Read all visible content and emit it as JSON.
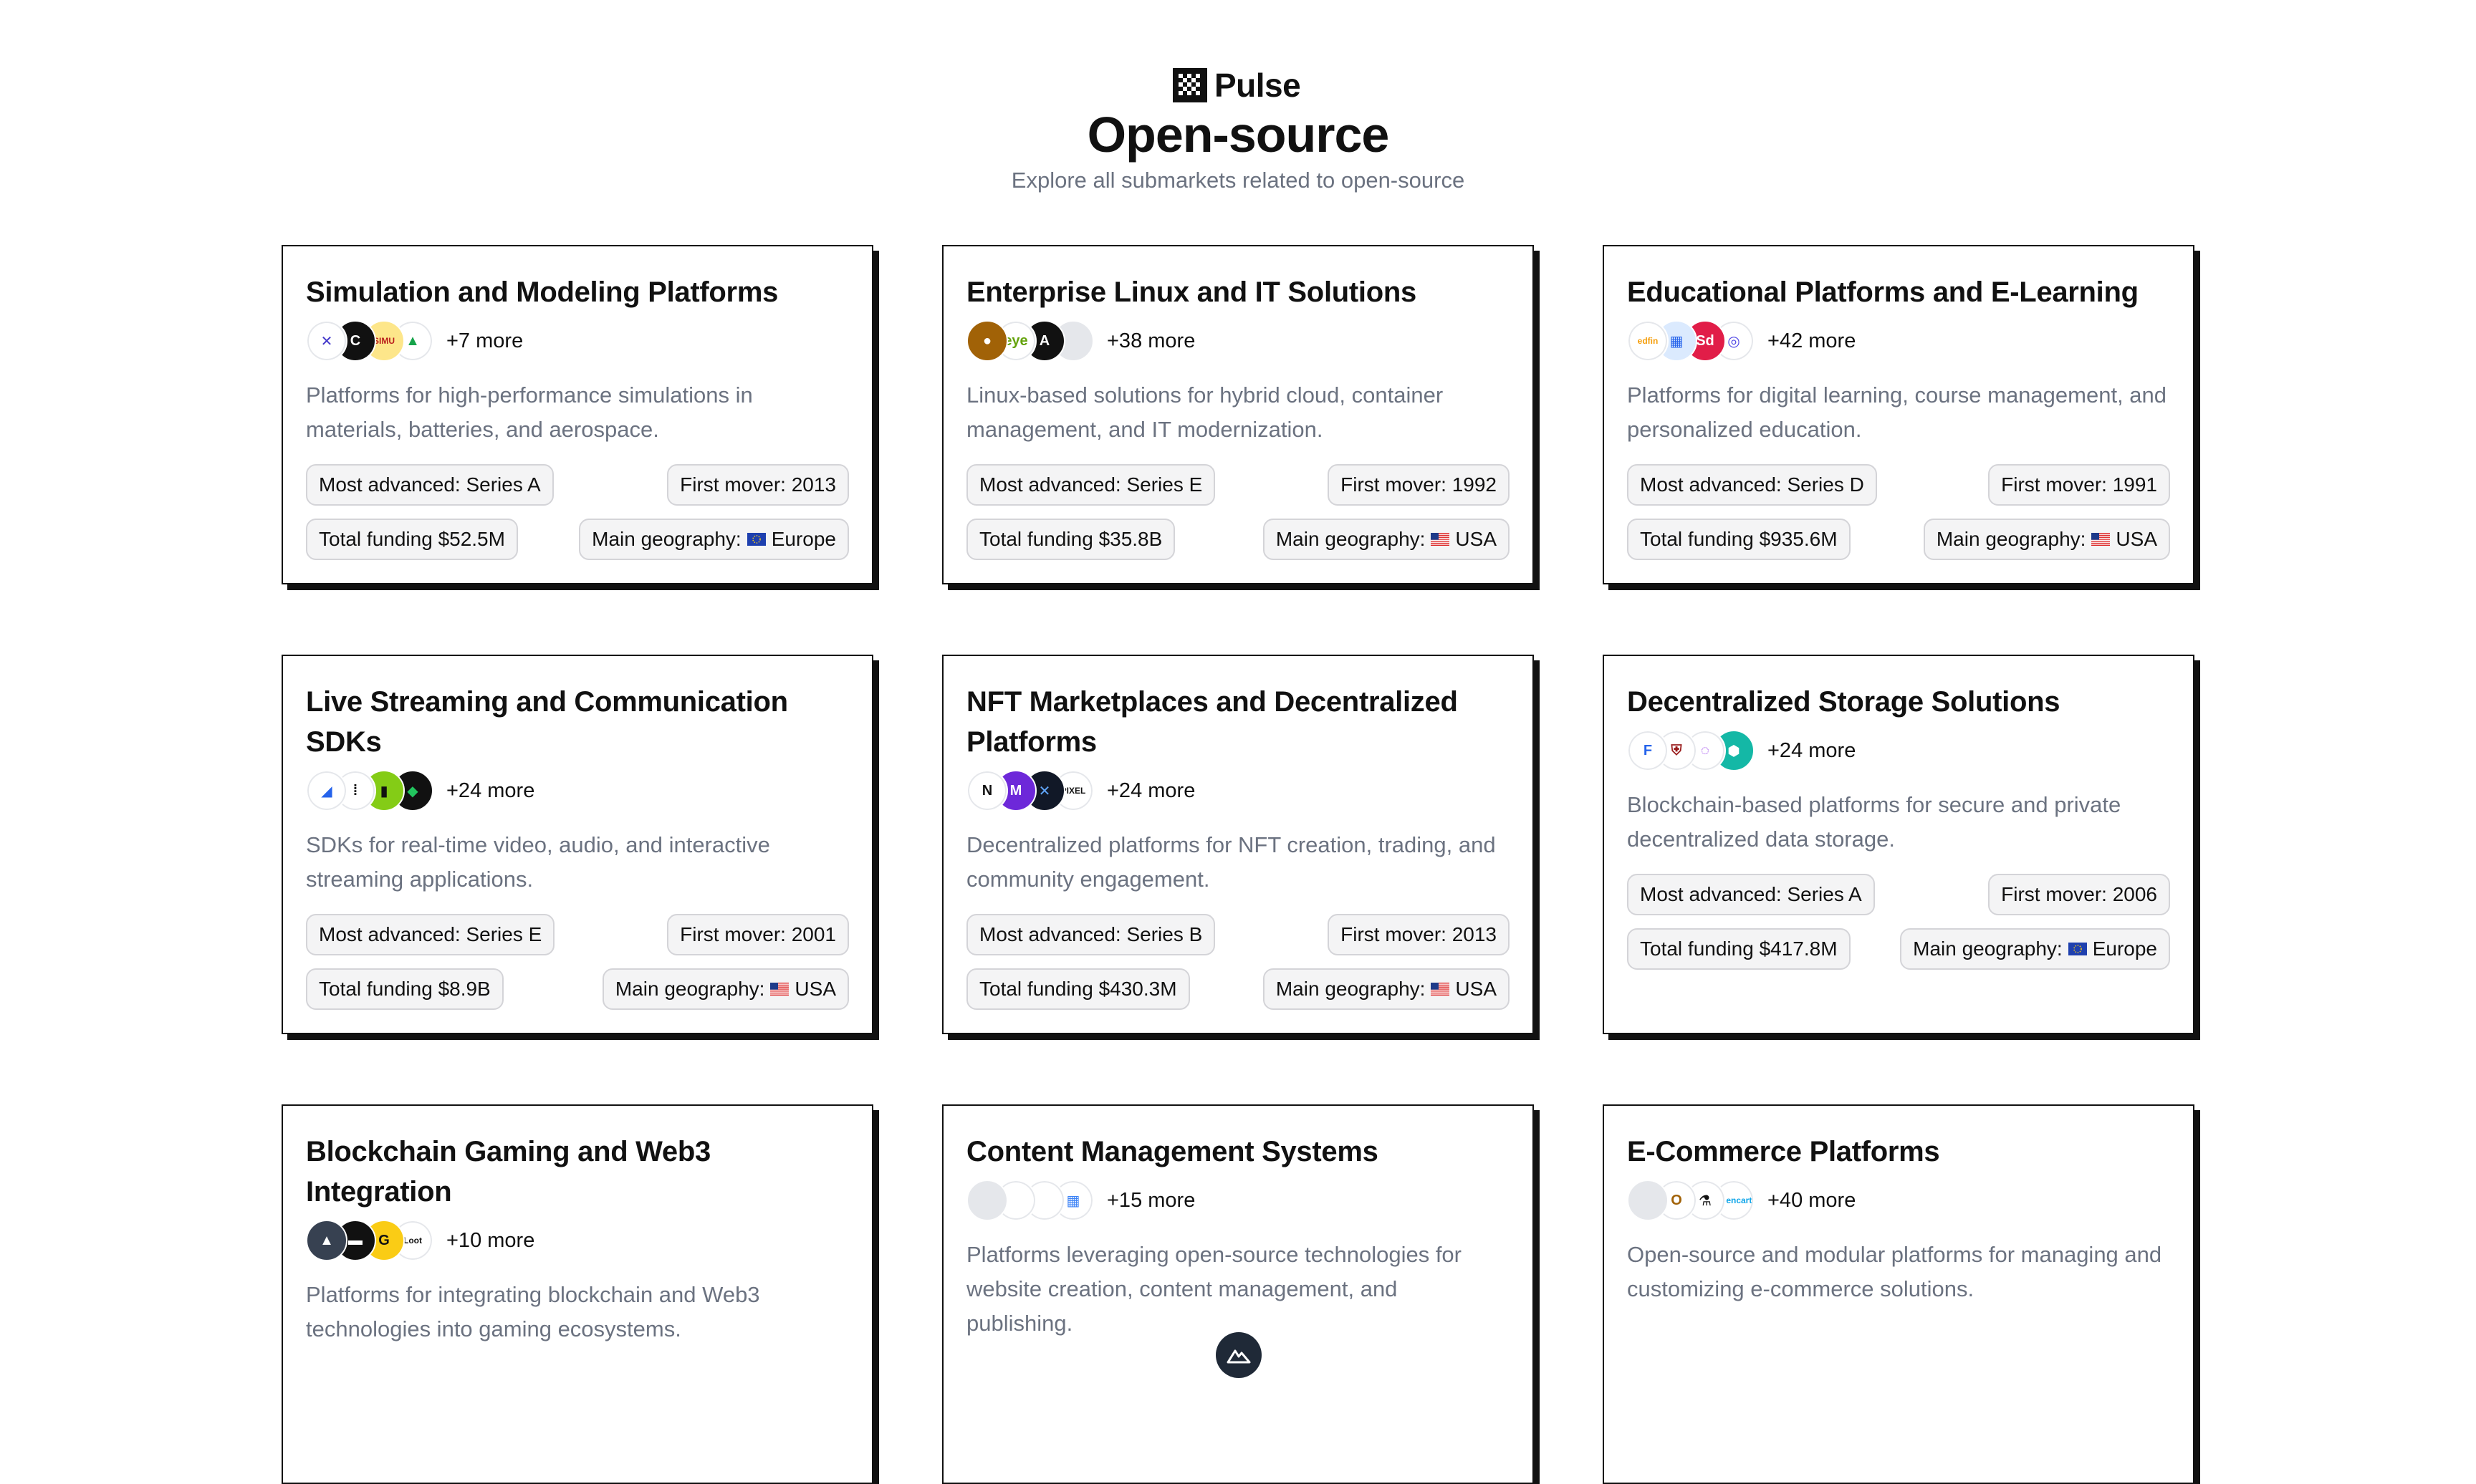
{
  "brand": {
    "name": "Pulse"
  },
  "page": {
    "title": "Open-source",
    "subtitle": "Explore all submarkets related to open-source"
  },
  "colors": {
    "border": "#111111",
    "muted": "#6b7280",
    "pill_bg": "#f4f4f5"
  },
  "cards": [
    {
      "title": "Simulation and Modeling Platforms",
      "more": "+7 more",
      "description": "Platforms for high-performance simulations in materials, batteries, and aerospace.",
      "stage": "Most advanced: Series A",
      "first_mover": "First mover: 2013",
      "funding": "Total funding $52.5M",
      "geo_label": "Main geography:",
      "geo": "Europe",
      "geo_flag": "eu-flag-icon",
      "logos": [
        {
          "bg": "#ffffff",
          "fg": "#4338ca",
          "text": "✕"
        },
        {
          "bg": "#111111",
          "fg": "#ffffff",
          "text": "C"
        },
        {
          "bg": "#fde68a",
          "fg": "#b91c1c",
          "text": "SIMU"
        },
        {
          "bg": "#ffffff",
          "fg": "#16a34a",
          "text": "▲"
        }
      ]
    },
    {
      "title": "Enterprise Linux and IT Solutions",
      "more": "+38 more",
      "description": "Linux-based solutions for hybrid cloud, container management, and IT modernization.",
      "stage": "Most advanced: Series E",
      "first_mover": "First mover: 1992",
      "funding": "Total funding $35.8B",
      "geo_label": "Main geography:",
      "geo": "USA",
      "geo_flag": "us-flag-icon",
      "logos": [
        {
          "bg": "#a16207",
          "fg": "#ffffff",
          "text": "●"
        },
        {
          "bg": "#ffffff",
          "fg": "#65a30d",
          "text": "eye"
        },
        {
          "bg": "#111111",
          "fg": "#ffffff",
          "text": "A"
        },
        {
          "bg": "#e5e7eb",
          "fg": "#9ca3af",
          "text": ""
        }
      ]
    },
    {
      "title": "Educational Platforms and E-Learning",
      "more": "+42 more",
      "description": "Platforms for digital learning, course management, and personalized education.",
      "stage": "Most advanced: Series D",
      "first_mover": "First mover: 1991",
      "funding": "Total funding $935.6M",
      "geo_label": "Main geography:",
      "geo": "USA",
      "geo_flag": "us-flag-icon",
      "logos": [
        {
          "bg": "#ffffff",
          "fg": "#f59e0b",
          "text": "edfin"
        },
        {
          "bg": "#dbeafe",
          "fg": "#2563eb",
          "text": "▦"
        },
        {
          "bg": "#e11d48",
          "fg": "#ffffff",
          "text": "Sd"
        },
        {
          "bg": "#ffffff",
          "fg": "#4f46e5",
          "text": "◎"
        }
      ]
    },
    {
      "title": "Live Streaming and Communication SDKs",
      "more": "+24 more",
      "description": "SDKs for real-time video, audio, and interactive streaming applications.",
      "stage": "Most advanced: Series E",
      "first_mover": "First mover: 2001",
      "funding": "Total funding $8.9B",
      "geo_label": "Main geography:",
      "geo": "USA",
      "geo_flag": "us-flag-icon",
      "logos": [
        {
          "bg": "#ffffff",
          "fg": "#2563eb",
          "text": "◢"
        },
        {
          "bg": "#ffffff",
          "fg": "#111111",
          "text": "⁞"
        },
        {
          "bg": "#84cc16",
          "fg": "#111111",
          "text": "▮"
        },
        {
          "bg": "#111111",
          "fg": "#22c55e",
          "text": "◆"
        }
      ]
    },
    {
      "title": "NFT Marketplaces and Decentralized Platforms",
      "more": "+24 more",
      "description": "Decentralized platforms for NFT creation, trading, and community engagement.",
      "stage": "Most advanced: Series B",
      "first_mover": "First mover: 2013",
      "funding": "Total funding $430.3M",
      "geo_label": "Main geography:",
      "geo": "USA",
      "geo_flag": "us-flag-icon",
      "logos": [
        {
          "bg": "#ffffff",
          "fg": "#111111",
          "text": "N"
        },
        {
          "bg": "#6d28d9",
          "fg": "#ffffff",
          "text": "M"
        },
        {
          "bg": "#111827",
          "fg": "#60a5fa",
          "text": "✕"
        },
        {
          "bg": "#ffffff",
          "fg": "#111111",
          "text": "PIXEL"
        }
      ]
    },
    {
      "title": "Decentralized Storage Solutions",
      "more": "+24 more",
      "description": "Blockchain-based platforms for secure and private decentralized data storage.",
      "stage": "Most advanced: Series A",
      "first_mover": "First mover: 2006",
      "funding": "Total funding $417.8M",
      "geo_label": "Main geography:",
      "geo": "Europe",
      "geo_flag": "eu-flag-icon",
      "logos": [
        {
          "bg": "#ffffff",
          "fg": "#2563eb",
          "text": "F"
        },
        {
          "bg": "#ffffff",
          "fg": "#991b1b",
          "text": "⛨"
        },
        {
          "bg": "#ffffff",
          "fg": "#9333ea",
          "text": "◌"
        },
        {
          "bg": "#14b8a6",
          "fg": "#ffffff",
          "text": "⬢"
        }
      ]
    },
    {
      "title": "Blockchain Gaming and Web3 Integration",
      "more": "+10 more",
      "description": "Platforms for integrating blockchain and Web3 technologies into gaming ecosystems.",
      "stage": "",
      "first_mover": "",
      "funding": "",
      "geo_label": "",
      "geo": "",
      "geo_flag": "",
      "logos": [
        {
          "bg": "#374151",
          "fg": "#ffffff",
          "text": "▲"
        },
        {
          "bg": "#111111",
          "fg": "#ffffff",
          "text": "▬"
        },
        {
          "bg": "#facc15",
          "fg": "#111111",
          "text": "G"
        },
        {
          "bg": "#ffffff",
          "fg": "#111111",
          "text": "Loot"
        }
      ]
    },
    {
      "title": "Content Management Systems",
      "more": "+15 more",
      "description": "Platforms leveraging open-source technologies for website creation, content management, and publishing.",
      "stage": "",
      "first_mover": "",
      "funding": "",
      "geo_label": "",
      "geo": "",
      "geo_flag": "",
      "logos": [
        {
          "bg": "#e5e7eb",
          "fg": "#9ca3af",
          "text": ""
        },
        {
          "bg": "#ffffff",
          "fg": "#ffffff",
          "text": ""
        },
        {
          "bg": "#ffffff",
          "fg": "#ffffff",
          "text": ""
        },
        {
          "bg": "#ffffff",
          "fg": "#3b82f6",
          "text": "▦"
        }
      ]
    },
    {
      "title": "E-Commerce Platforms",
      "more": "+40 more",
      "description": "Open-source and modular platforms for managing and customizing e-commerce solutions.",
      "stage": "",
      "first_mover": "",
      "funding": "",
      "geo_label": "",
      "geo": "",
      "geo_flag": "",
      "logos": [
        {
          "bg": "#e5e7eb",
          "fg": "#9ca3af",
          "text": ""
        },
        {
          "bg": "#ffffff",
          "fg": "#a16207",
          "text": "O"
        },
        {
          "bg": "#ffffff",
          "fg": "#111111",
          "text": "⚗"
        },
        {
          "bg": "#ffffff",
          "fg": "#0ea5e9",
          "text": "opencart"
        }
      ]
    }
  ]
}
